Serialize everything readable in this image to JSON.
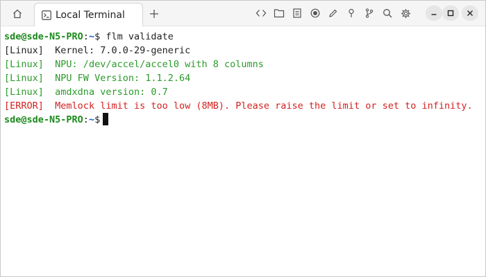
{
  "tabs": [
    {
      "label": "Local Terminal",
      "active": true
    }
  ],
  "toolbar_icons": [
    "code-brackets-icon",
    "folder-icon",
    "document-icon",
    "record-icon",
    "pencil-icon",
    "pin-icon",
    "branch-icon",
    "search-icon",
    "gear-icon"
  ],
  "window_controls": [
    "minimize-icon",
    "maximize-icon",
    "close-icon"
  ],
  "colors": {
    "prompt_user": "#1a8a1a",
    "prompt_path": "#1c55c7",
    "success": "#2a9a2a",
    "error": "#d42020",
    "text": "#222222"
  },
  "terminal": {
    "prompt": {
      "user_host": "sde@sde-N5-PRO",
      "sep": ":",
      "path": "~",
      "symbol": "$"
    },
    "command": "flm validate",
    "output": [
      {
        "tag": "[Linux]",
        "text": "Kernel: 7.0.0-29-generic",
        "status": "plain"
      },
      {
        "tag": "[Linux]",
        "text": "NPU: /dev/accel/accel0 with 8 columns",
        "status": "success"
      },
      {
        "tag": "[Linux]",
        "text": "NPU FW Version: 1.1.2.64",
        "status": "success"
      },
      {
        "tag": "[Linux]",
        "text": "amdxdna version: 0.7",
        "status": "success"
      },
      {
        "tag": "[ERROR]",
        "text": "Memlock limit is too low (8MB). Please raise the limit or set to infinity.",
        "status": "error"
      }
    ]
  }
}
